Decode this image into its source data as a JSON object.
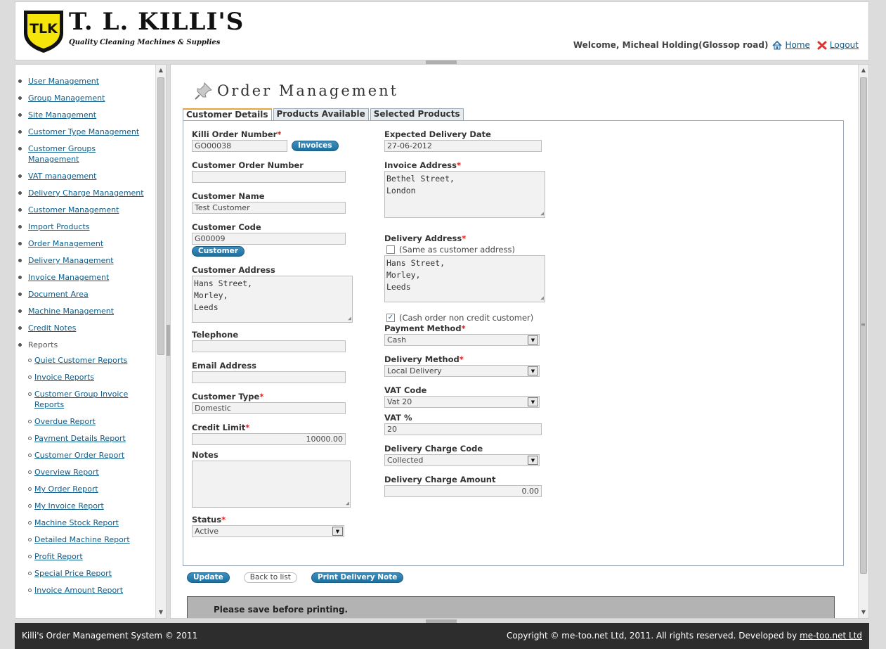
{
  "header": {
    "logo_mark": "TLK",
    "company": "T. L. KILLI'S",
    "tagline": "Quality Cleaning Machines & Supplies",
    "welcome": "Welcome, Micheal Holding(Glossop road)",
    "home": "Home",
    "logout": "Logout"
  },
  "sidebar": {
    "items": [
      {
        "label": "User Management"
      },
      {
        "label": "Group Management"
      },
      {
        "label": "Site Management"
      },
      {
        "label": "Customer Type Management"
      },
      {
        "label": "Customer Groups Management"
      },
      {
        "label": "VAT management"
      },
      {
        "label": "Delivery Charge Management"
      },
      {
        "label": "Customer Management"
      },
      {
        "label": "Import Products"
      },
      {
        "label": "Order Management"
      },
      {
        "label": "Delivery Management"
      },
      {
        "label": "Invoice Management"
      },
      {
        "label": "Document Area"
      },
      {
        "label": "Machine Management"
      },
      {
        "label": "Credit Notes"
      }
    ],
    "reports_label": "Reports",
    "reports": [
      {
        "label": "Quiet Customer Reports"
      },
      {
        "label": "Invoice Reports"
      },
      {
        "label": "Customer Group Invoice Reports"
      },
      {
        "label": "Overdue Report"
      },
      {
        "label": "Payment Details Report"
      },
      {
        "label": "Customer Order Report"
      },
      {
        "label": "Overview Report"
      },
      {
        "label": "My Order Report"
      },
      {
        "label": "My Invoice Report"
      },
      {
        "label": "Machine Stock Report"
      },
      {
        "label": "Detailed Machine Report"
      },
      {
        "label": "Profit Report"
      },
      {
        "label": "Special Price Report"
      },
      {
        "label": "Invoice Amount Report"
      }
    ]
  },
  "main": {
    "title": "Order Management",
    "tabs": [
      {
        "label": "Customer Details"
      },
      {
        "label": "Products Available"
      },
      {
        "label": "Selected Products"
      }
    ],
    "form": {
      "killi_order_number": {
        "label": "Killi Order Number",
        "value": "GO00038"
      },
      "invoices_button": "Invoices",
      "customer_order_number": {
        "label": "Customer Order Number",
        "value": ""
      },
      "customer_name": {
        "label": "Customer Name",
        "value": "Test Customer"
      },
      "customer_code": {
        "label": "Customer Code",
        "value": "G00009"
      },
      "customer_button": "Customer",
      "customer_address": {
        "label": "Customer Address",
        "value": "Hans Street,\nMorley,\nLeeds"
      },
      "telephone": {
        "label": "Telephone",
        "value": ""
      },
      "email": {
        "label": "Email Address",
        "value": ""
      },
      "customer_type": {
        "label": "Customer Type",
        "value": "Domestic"
      },
      "credit_limit": {
        "label": "Credit Limit",
        "value": "10000.00"
      },
      "notes": {
        "label": "Notes",
        "value": ""
      },
      "status": {
        "label": "Status",
        "value": "Active"
      },
      "expected_delivery_date": {
        "label": "Expected Delivery Date",
        "value": "27-06-2012"
      },
      "invoice_address": {
        "label": "Invoice Address",
        "value": "Bethel Street,\nLondon"
      },
      "delivery_address": {
        "label": "Delivery Address",
        "value": "Hans Street,\nMorley,\nLeeds"
      },
      "same_as_customer": {
        "label": "(Same as customer address)",
        "checked": false
      },
      "cash_order": {
        "label": "(Cash order non credit customer)",
        "checked": true
      },
      "payment_method": {
        "label": "Payment Method",
        "value": "Cash"
      },
      "delivery_method": {
        "label": "Delivery Method",
        "value": "Local Delivery"
      },
      "vat_code": {
        "label": "VAT Code",
        "value": "Vat 20"
      },
      "vat_percent": {
        "label": "VAT %",
        "value": "20"
      },
      "delivery_charge_code": {
        "label": "Delivery Charge Code",
        "value": "Collected"
      },
      "delivery_charge_amount": {
        "label": "Delivery Charge Amount",
        "value": "0.00"
      }
    },
    "actions": {
      "update": "Update",
      "back": "Back to list",
      "print": "Print Delivery Note"
    },
    "notice": "Please save before printing."
  },
  "footer": {
    "left": "Killi's Order Management System © 2011",
    "right_prefix": "Copyright © me-too.net Ltd, 2011. All rights reserved. Developed by",
    "right_link": "me-too.net Ltd"
  },
  "colors": {
    "accent_blue": "#1f6f9e",
    "link": "#0d5c8a",
    "footer_bg": "#2d2d2d",
    "required": "#dd2222",
    "logo_yellow": "#f5e50a"
  }
}
